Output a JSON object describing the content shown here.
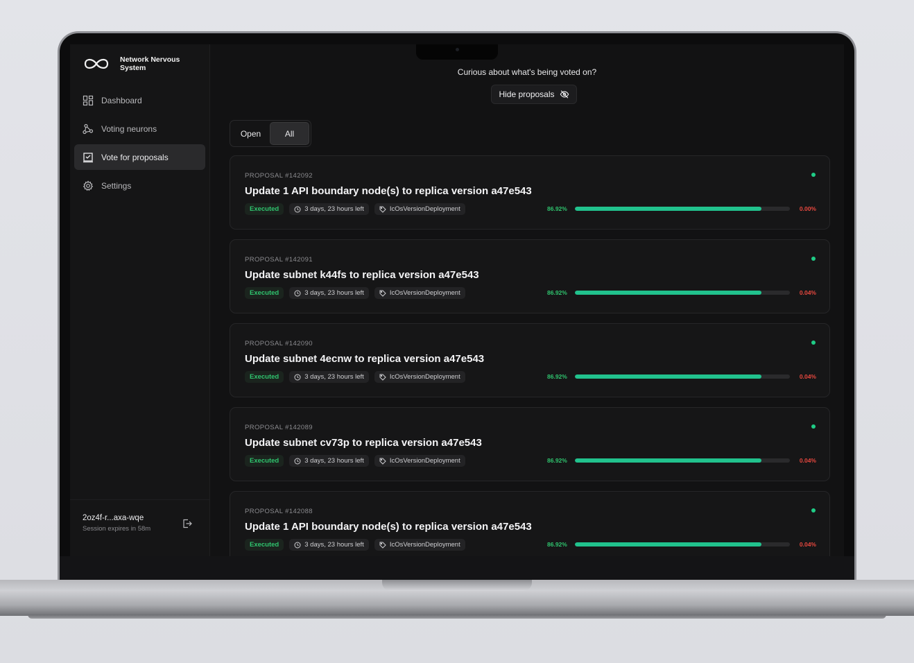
{
  "sidebar": {
    "brand": "Network Nervous System",
    "nav": [
      {
        "label": "Dashboard",
        "icon": "grid-icon",
        "active": false
      },
      {
        "label": "Voting neurons",
        "icon": "neurons-icon",
        "active": false
      },
      {
        "label": "Vote for proposals",
        "icon": "ballot-icon",
        "active": true
      },
      {
        "label": "Settings",
        "icon": "gear-icon",
        "active": false
      }
    ],
    "session": {
      "id": "2oz4f-r...axa-wqe",
      "expires": "Session expires in 58m"
    }
  },
  "main": {
    "prompt": "Curious about what's being voted on?",
    "hide_label": "Hide proposals",
    "tabs": [
      {
        "label": "Open",
        "active": false
      },
      {
        "label": "All",
        "active": true
      }
    ],
    "proposals": [
      {
        "id": "PROPOSAL #142092",
        "title": "Update 1 API boundary node(s) to replica version a47e543",
        "status": "Executed",
        "time": "3 days, 23 hours left",
        "topic": "IcOsVersionDeployment",
        "yes": "86.92%",
        "no": "0.00%",
        "yes_value": 86.92
      },
      {
        "id": "PROPOSAL #142091",
        "title": "Update subnet k44fs to replica version a47e543",
        "status": "Executed",
        "time": "3 days, 23 hours left",
        "topic": "IcOsVersionDeployment",
        "yes": "86.92%",
        "no": "0.04%",
        "yes_value": 86.92
      },
      {
        "id": "PROPOSAL #142090",
        "title": "Update subnet 4ecnw to replica version a47e543",
        "status": "Executed",
        "time": "3 days, 23 hours left",
        "topic": "IcOsVersionDeployment",
        "yes": "86.92%",
        "no": "0.04%",
        "yes_value": 86.92
      },
      {
        "id": "PROPOSAL #142089",
        "title": "Update subnet cv73p to replica version a47e543",
        "status": "Executed",
        "time": "3 days, 23 hours left",
        "topic": "IcOsVersionDeployment",
        "yes": "86.92%",
        "no": "0.04%",
        "yes_value": 86.92
      },
      {
        "id": "PROPOSAL #142088",
        "title": "Update 1 API boundary node(s) to replica version a47e543",
        "status": "Executed",
        "time": "3 days, 23 hours left",
        "topic": "IcOsVersionDeployment",
        "yes": "86.92%",
        "no": "0.04%",
        "yes_value": 86.92
      }
    ]
  },
  "colors": {
    "accent": "#21c28d",
    "executed": "#2fc46e",
    "reject": "#e8483f",
    "background": "#121213"
  }
}
